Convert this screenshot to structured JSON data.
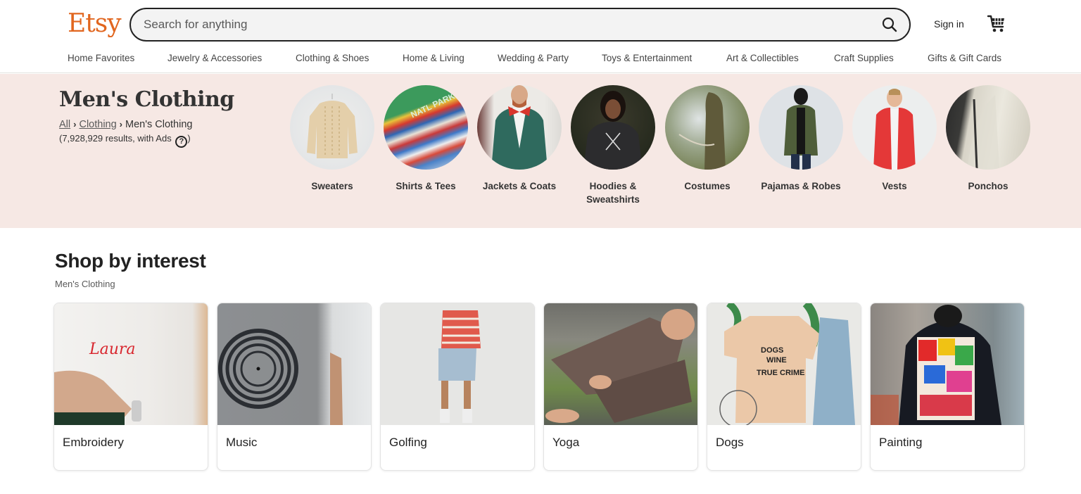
{
  "header": {
    "logo": "Etsy",
    "logo_color": "#e1661f",
    "search": {
      "placeholder": "Search for anything",
      "value": ""
    },
    "search_icon": "search-icon",
    "sign_in": "Sign in",
    "cart_icon": "cart-icon"
  },
  "nav": {
    "items": [
      {
        "label": "Home Favorites"
      },
      {
        "label": "Jewelry & Accessories"
      },
      {
        "label": "Clothing & Shoes"
      },
      {
        "label": "Home & Living"
      },
      {
        "label": "Wedding & Party"
      },
      {
        "label": "Toys & Entertainment"
      },
      {
        "label": "Art & Collectibles"
      },
      {
        "label": "Craft Supplies"
      },
      {
        "label": "Gifts & Gift Cards"
      }
    ]
  },
  "hero": {
    "title": "Men's Clothing",
    "background": "#f6e8e4",
    "breadcrumb": [
      {
        "label": "All"
      },
      {
        "label": "Clothing"
      },
      {
        "label": "Men's Clothing"
      }
    ],
    "results_text": "(7,928,929 results, with Ads",
    "results_close": ")",
    "help_icon": "?",
    "categories": [
      {
        "label": "Sweaters"
      },
      {
        "label": "Shirts & Tees"
      },
      {
        "label": "Jackets & Coats"
      },
      {
        "label": "Hoodies & Sweatshirts"
      },
      {
        "label": "Costumes"
      },
      {
        "label": "Pajamas & Robes"
      },
      {
        "label": "Vests"
      },
      {
        "label": "Ponchos"
      }
    ]
  },
  "shop_by_interest": {
    "title": "Shop by interest",
    "subtitle": "Men's Clothing",
    "cards": [
      {
        "label": "Embroidery"
      },
      {
        "label": "Music"
      },
      {
        "label": "Golfing"
      },
      {
        "label": "Yoga"
      },
      {
        "label": "Dogs"
      },
      {
        "label": "Painting"
      }
    ]
  }
}
